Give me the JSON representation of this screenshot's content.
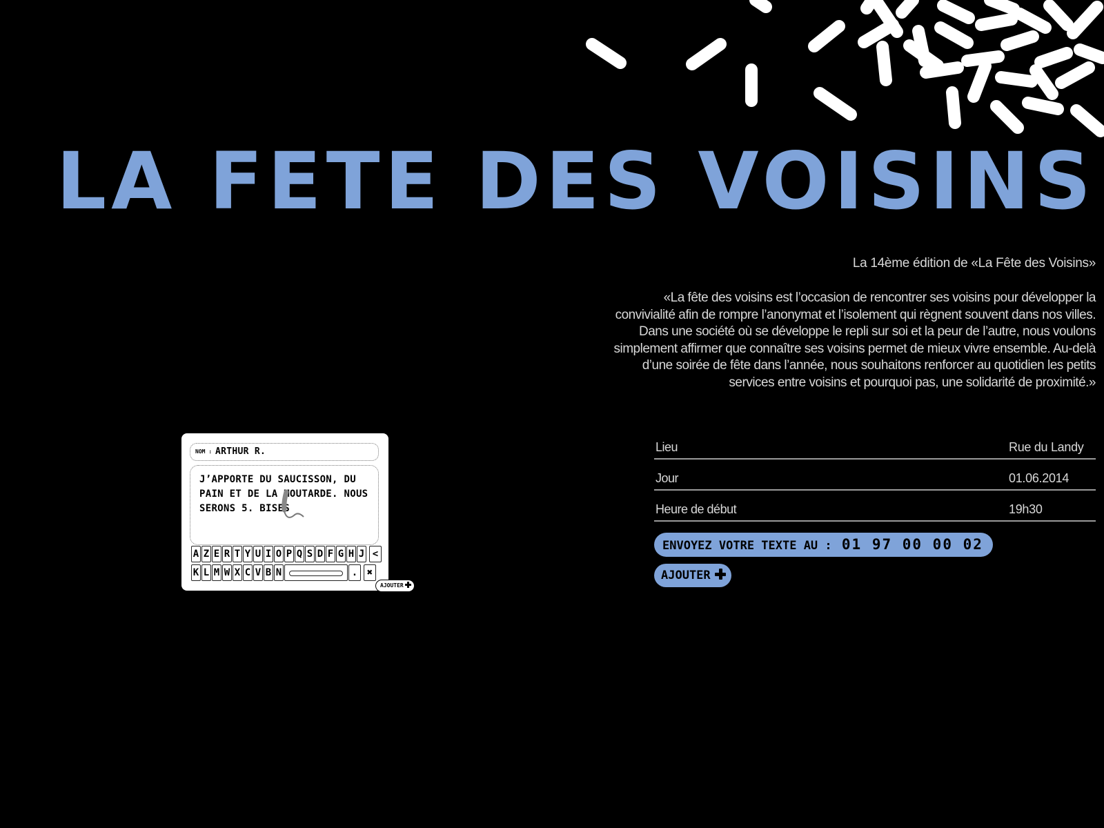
{
  "header": {
    "title": "LA FETE DES VOISINS"
  },
  "intro": {
    "subtitle": "La 14ème édition de «La Fête des Voisins»",
    "quote": "«La fête des voisins est l’occasion de rencontrer ses voisins pour développer la convivialité afin de rompre l’anonymat et l’isolement qui règnent souvent dans nos villes. Dans une société où se développe le repli sur soi et la peur de l’autre, nous voulons simplement affirmer que connaître ses voisins permet de mieux vivre ensemble. Au-delà d’une soirée de fête dans l’année, nous souhaitons renforcer au quotidien les petits services entre voisins et pourquoi pas, une solidarité de proximité.»"
  },
  "info": {
    "rows": [
      {
        "label": "Lieu",
        "value": "Rue du Landy"
      },
      {
        "label": "Jour",
        "value": "01.06.2014"
      },
      {
        "label": "Heure de début",
        "value": "19h30"
      }
    ]
  },
  "actions": {
    "sms_label": "ENVOYEZ VOTRE TEXTE AU :",
    "sms_number": "01 97 00 00 02",
    "add_label": "AJOUTER"
  },
  "note": {
    "name_label": "NOM :",
    "name_value": "ARTHUR R.",
    "message": "J’APPORTE DU SAUCISSON, DU PAIN ET DE LA MOUTARDE. NOUS SERONS 5. BISES",
    "keyboard_row1": [
      "A",
      "Z",
      "E",
      "R",
      "T",
      "Y",
      "U",
      "I",
      "O",
      "P",
      "Q",
      "S",
      "D",
      "F",
      "G",
      "H",
      "J"
    ],
    "keyboard_row1_end": "<",
    "keyboard_row2": [
      "K",
      "L",
      "M",
      "W",
      "X",
      "C",
      "V",
      "B",
      "N"
    ],
    "key_dot": ".",
    "key_close": "✖",
    "add_label": "AJOUTER"
  },
  "colors": {
    "accent": "#7fa3d9",
    "background": "#000000",
    "text": "#d8d8d8"
  }
}
